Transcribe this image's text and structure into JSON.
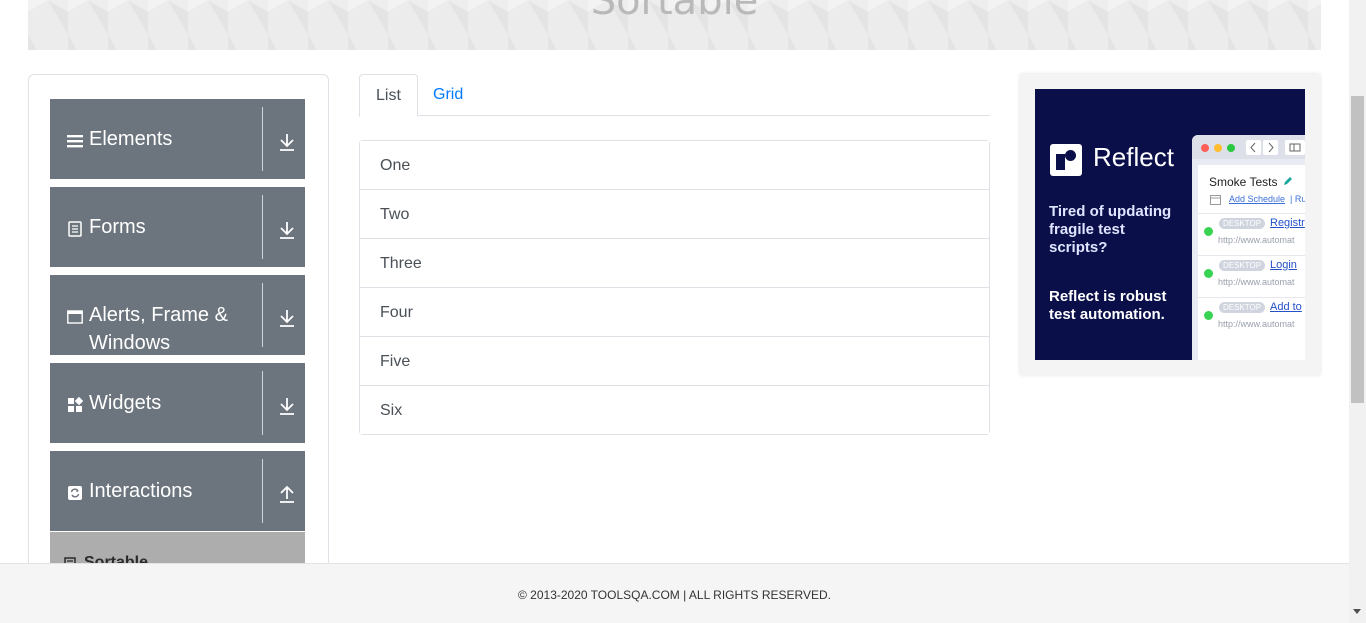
{
  "header": {
    "title": "Sortable"
  },
  "sidebar": {
    "groups": [
      {
        "label": "Elements",
        "icon": "hamburger-icon",
        "toggle_icon": "download-arrow-icon"
      },
      {
        "label": "Forms",
        "icon": "document-icon",
        "toggle_icon": "download-arrow-icon"
      },
      {
        "label": "Alerts, Frame & Windows",
        "icon": "window-icon",
        "toggle_icon": "download-arrow-icon"
      },
      {
        "label": "Widgets",
        "icon": "widgets-icon",
        "toggle_icon": "download-arrow-icon"
      },
      {
        "label": "Interactions",
        "icon": "refresh-icon",
        "toggle_icon": "upload-arrow-icon"
      }
    ],
    "active_item": {
      "label": "Sortable",
      "icon": "document-icon"
    }
  },
  "tabs": [
    {
      "label": "List",
      "active": true
    },
    {
      "label": "Grid",
      "active": false
    }
  ],
  "list_items": [
    "One",
    "Two",
    "Three",
    "Four",
    "Five",
    "Six"
  ],
  "ad": {
    "brand": "Reflect",
    "text1": "Tired of updating fragile test scripts?",
    "text2": "Reflect is robust test automation.",
    "window_title": "Smoke Tests",
    "schedule_link": "Add Schedule",
    "schedule_sep": "| Ru",
    "rows": [
      {
        "tag": "DESKTOP",
        "link": "Registr",
        "url": "http://www.automat"
      },
      {
        "tag": "DESKTOP",
        "link": "Login",
        "url": "http://www.automat"
      },
      {
        "tag": "DESKTOP",
        "link": "Add to",
        "url": "http://www.automat"
      }
    ]
  },
  "footer": {
    "text": "© 2013-2020 TOOLSQA.COM | ALL RIGHTS RESERVED."
  },
  "colors": {
    "sidebar_group": "#6c757d",
    "active_item": "#adadad",
    "link": "#007bff",
    "ad_bg": "#0a0f4a"
  }
}
